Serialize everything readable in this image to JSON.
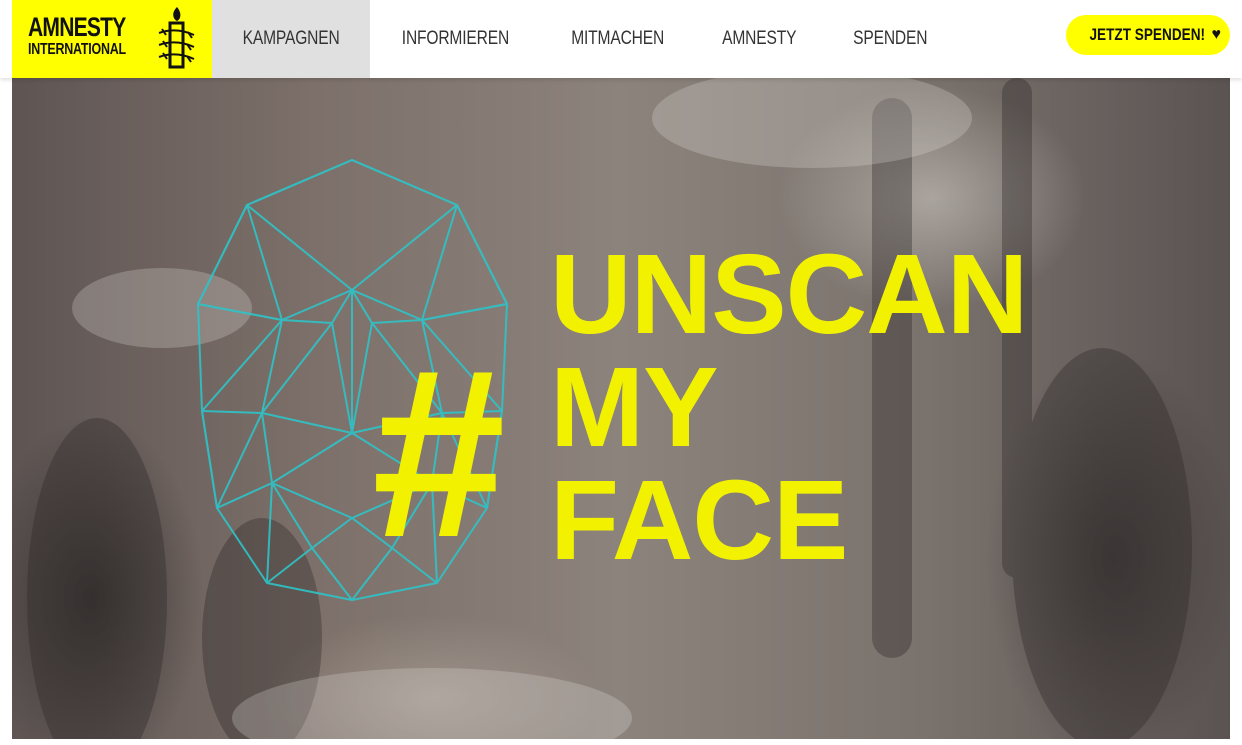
{
  "brand": {
    "line1": "AMNESTY",
    "line2": "INTERNATIONAL",
    "logo_icon": "candle-barbed-wire-icon",
    "color": "#ffff00"
  },
  "nav": {
    "items": [
      {
        "label": "KAMPAGNEN",
        "active": true
      },
      {
        "label": "INFORMIEREN",
        "active": false
      },
      {
        "label": "MITMACHEN",
        "active": false
      },
      {
        "label": "AMNESTY",
        "active": false
      },
      {
        "label": "SPENDEN",
        "active": false
      }
    ]
  },
  "donate": {
    "label": "JETZT SPENDEN!",
    "icon": "heart-icon"
  },
  "hero": {
    "hash": "#",
    "line1": "UNSCAN",
    "line2": "MY",
    "line3": "FACE",
    "accent_color": "#f2f200",
    "face_mesh_color": "#2ec4c8",
    "face_icon": "face-scan-mesh-icon"
  }
}
